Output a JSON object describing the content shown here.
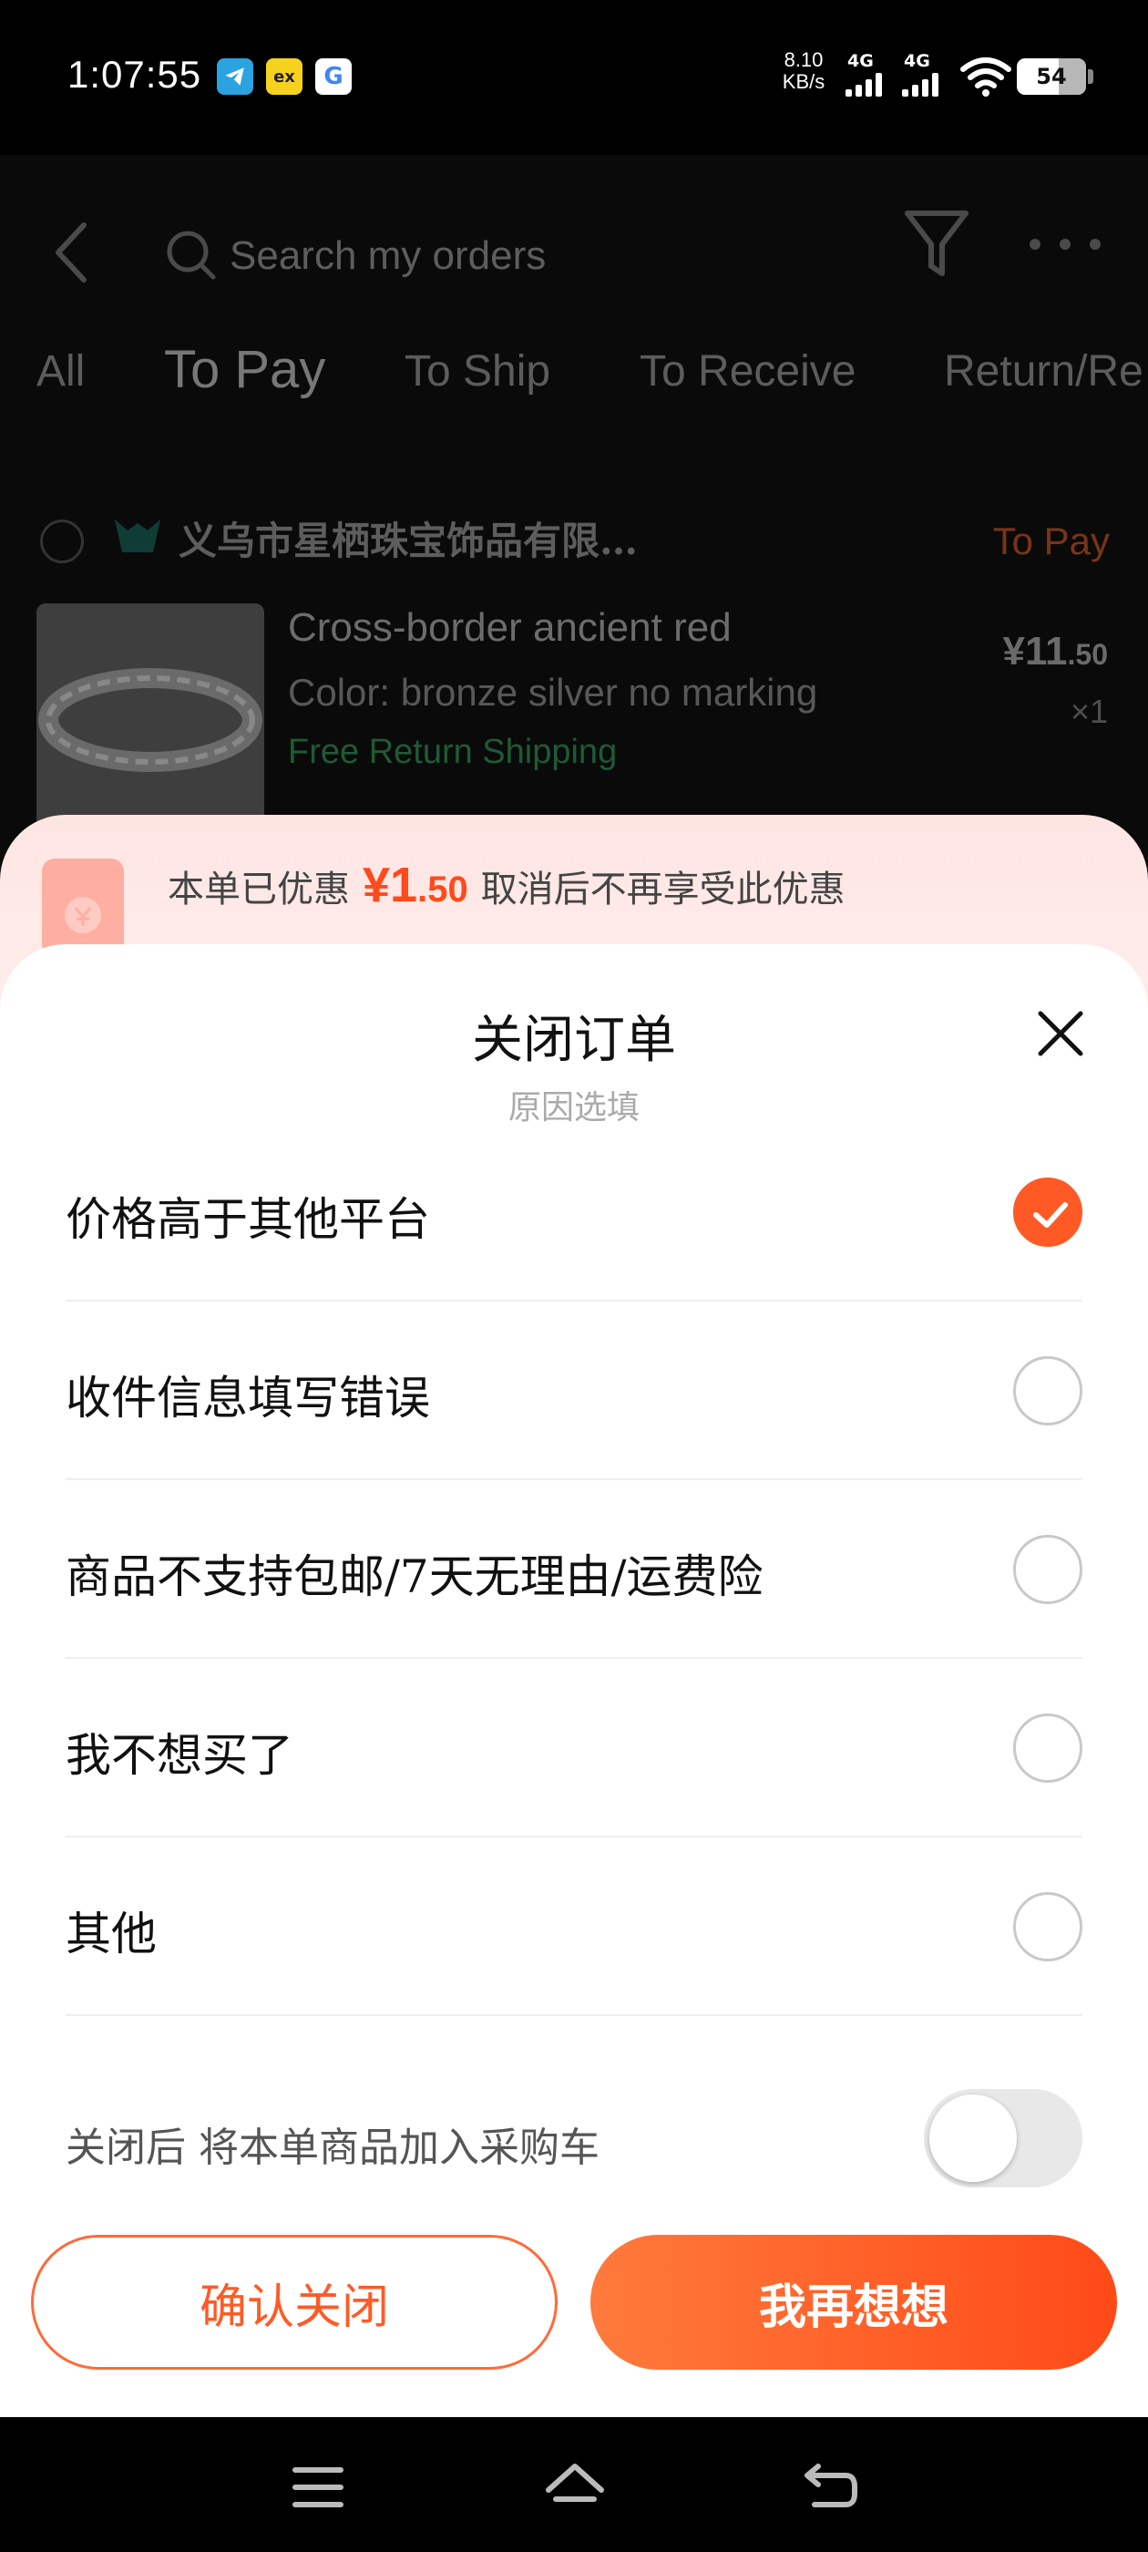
{
  "status_bar": {
    "time": "1:07:55",
    "apps": [
      "telegram-icon",
      "ex-icon",
      "google-icon"
    ],
    "ex_label": "ex",
    "google_label": "G",
    "net_speed_value": "8.10",
    "net_speed_unit": "KB/s",
    "signal_1": "4G",
    "signal_2": "4G",
    "battery": "54"
  },
  "header": {
    "search_placeholder": "Search my orders"
  },
  "tabs": [
    {
      "label": "All"
    },
    {
      "label": "To Pay"
    },
    {
      "label": "To Ship"
    },
    {
      "label": "To Receive"
    },
    {
      "label": "Return/Re"
    }
  ],
  "order": {
    "shop_name": "义乌市星栖珠宝饰品有限…",
    "status": "To Pay",
    "product_title": "Cross-border ancient red",
    "product_color": "Color: bronze silver no marking",
    "shipping": "Free Return Shipping",
    "price_main": "¥11",
    "price_cents": ".50",
    "quantity": "×1"
  },
  "sheet": {
    "discount_prefix": "本单已优惠",
    "discount_main": "¥1",
    "discount_cents": ".50",
    "discount_suffix": "取消后不再享受此优惠",
    "title": "关闭订单",
    "subtitle": "原因选填",
    "reasons": [
      {
        "label": "价格高于其他平台",
        "selected": true
      },
      {
        "label": "收件信息填写错误",
        "selected": false
      },
      {
        "label": "商品不支持包邮/7天无理由/运费险",
        "selected": false
      },
      {
        "label": "我不想买了",
        "selected": false
      },
      {
        "label": "其他",
        "selected": false
      }
    ],
    "add_to_cart_label": "关闭后 将本单商品加入采购车",
    "add_to_cart_enabled": false,
    "confirm_button": "确认关闭",
    "rethink_button": "我再想想"
  },
  "colors": {
    "accent": "#ff5a26",
    "accent_dark": "#ff4a17"
  }
}
